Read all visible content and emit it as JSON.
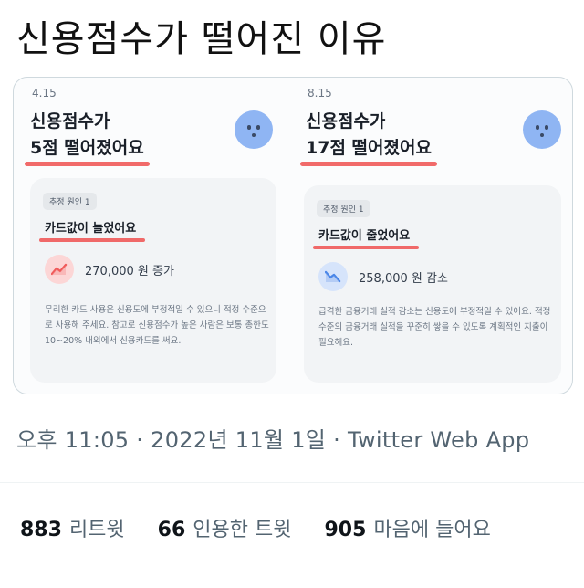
{
  "tweet": {
    "text": "신용점수가 떨어진 이유"
  },
  "image": {
    "left_panel": {
      "date": "4.15",
      "headline_line1": "신용점수가",
      "headline_line2": "5점 떨어졌어요",
      "reason_tag": "추정 원인 1",
      "reason_title": "카드값이 늘었어요",
      "amount": "270,000 원 증가",
      "amount_icon": "trend-up-icon",
      "description": "무리한 카드 사용은 신용도에 부정적일 수 있으니 적정 수준으로 사용해 주세요. 참고로 신용점수가 높은 사람은 보통 총한도 10~20% 내외에서 신용카드를 써요."
    },
    "right_panel": {
      "date": "8.15",
      "headline_line1": "신용점수가",
      "headline_line2": "17점 떨어졌어요",
      "reason_tag": "추정 원인 1",
      "reason_title": "카드값이 줄었어요",
      "amount": "258,000 원 감소",
      "amount_icon": "trend-down-icon",
      "description": "급격한 금융거래 실적 감소는 신용도에 부정적일 수 있어요. 적정 수준의 금융거래 실적을 꾸준히 쌓을 수 있도록 계획적인 지출이 필요해요."
    },
    "colors": {
      "underline": "#f05a5a",
      "face": "#8fb5f3",
      "up_icon_bg": "#fcd6d6",
      "down_icon_bg": "#d6e4fb"
    }
  },
  "meta": {
    "time": "오후 11:05",
    "separator": "·",
    "date": "2022년 11월 1일",
    "app": "Twitter Web App"
  },
  "stats": {
    "retweets_count": "883",
    "retweets_label": "리트윗",
    "quotes_count": "66",
    "quotes_label": "인용한 트윗",
    "likes_count": "905",
    "likes_label": "마음에 들어요"
  }
}
